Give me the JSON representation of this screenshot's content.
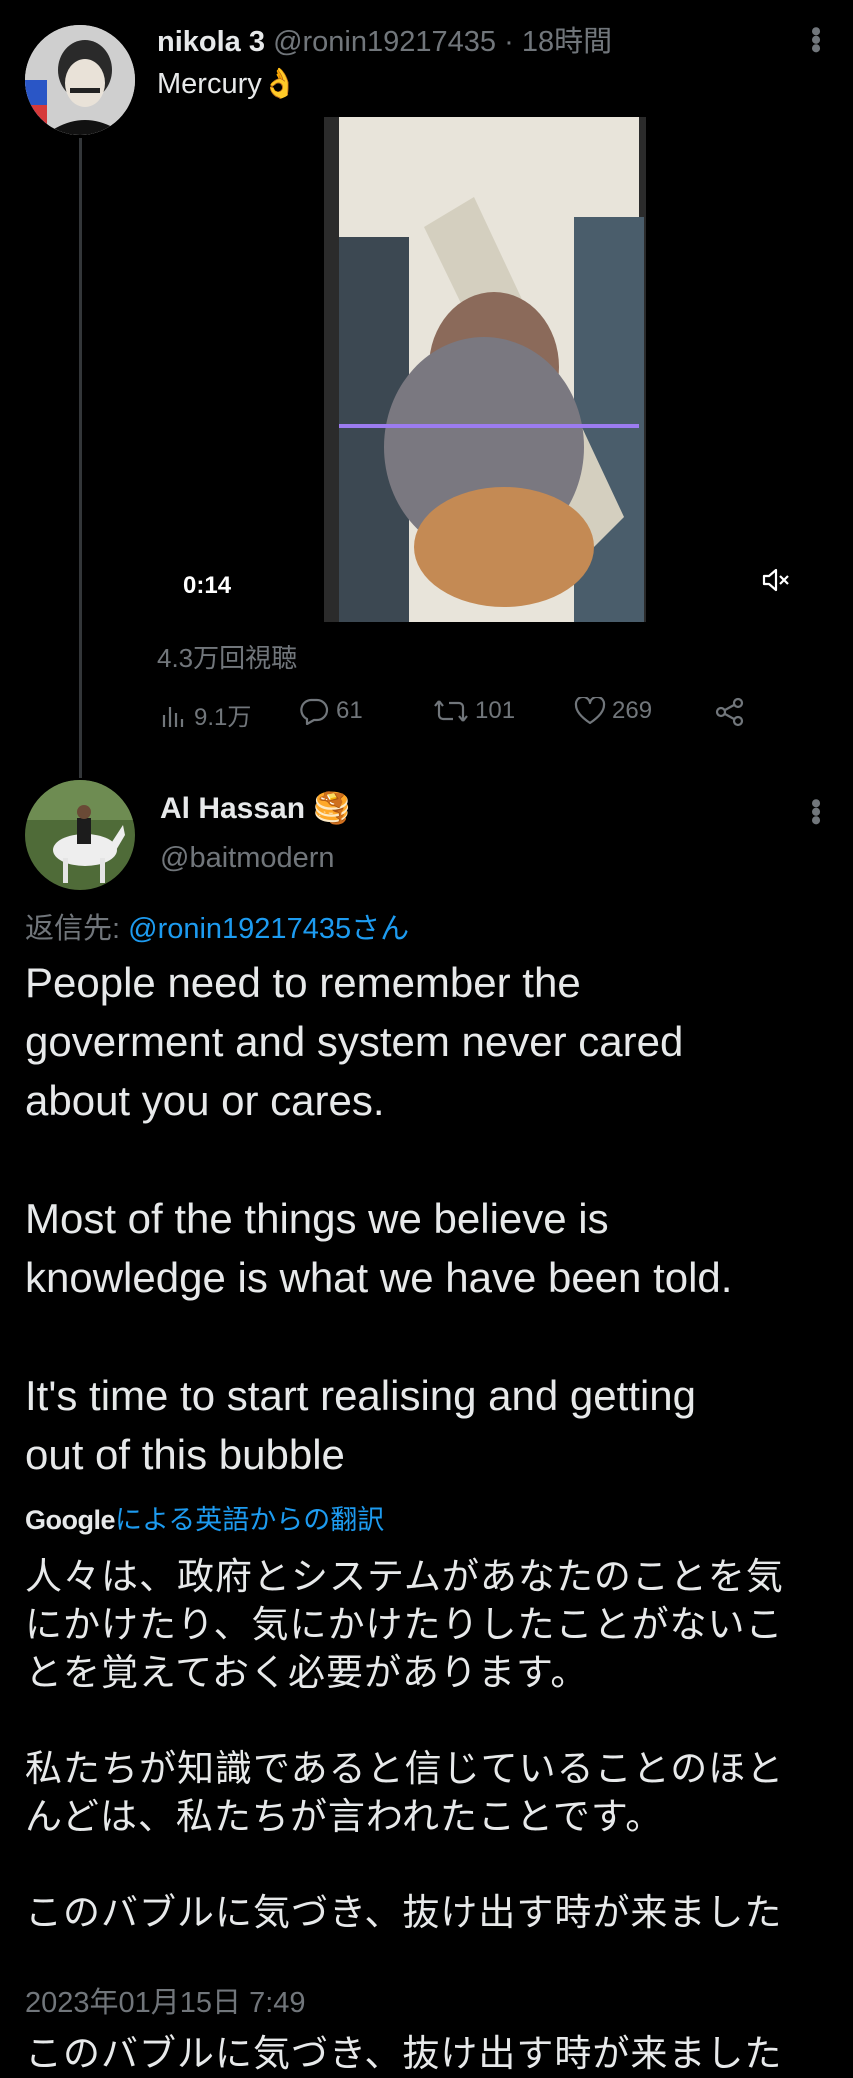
{
  "tweet1": {
    "display_name": "nikola 3",
    "handle": "@ronin19217435",
    "separator": "·",
    "time": "18時間",
    "text": "Mercury",
    "emoji": "👌",
    "video": {
      "time_label": "0:14",
      "mute_icon": "speaker-mute-icon"
    },
    "views_text": "4.3万回視聴",
    "actions": {
      "analytics": "9.1万",
      "replies": "61",
      "retweets": "101",
      "likes": "269"
    }
  },
  "tweet2": {
    "display_name": "Al Hassan",
    "name_emoji": "🥞",
    "handle": "@baitmodern",
    "reply_prefix": "返信先: ",
    "reply_to": "@ronin19217435さん",
    "body": "People need to remember the\ngoverment and system never cared\nabout you or cares.\n\nMost of the things we believe is\nknowledge is what we have been told.\n\nIt's time to start realising and getting\nout of this bubble",
    "translation_brand": "Google",
    "translation_label": "による英語からの翻訳",
    "translation": "人々は、政府とシステムがあなたのことを気\nにかけたり、気にかけたりしたことがないこ\nとを覚えておく必要があります。\n\n私たちが知識であると信じていることのほと\nんどは、私たちが言われたことです。\n\nこのバブルに気づき、抜け出す時が来ました",
    "timestamp": "2023年01月15日 7:49",
    "cutoff_text": "このバブルに気づき、抜け出す時が来ました"
  },
  "colors": {
    "background": "#000000",
    "text": "#e7e9ea",
    "muted": "#71767b",
    "link": "#1d9bf0"
  }
}
